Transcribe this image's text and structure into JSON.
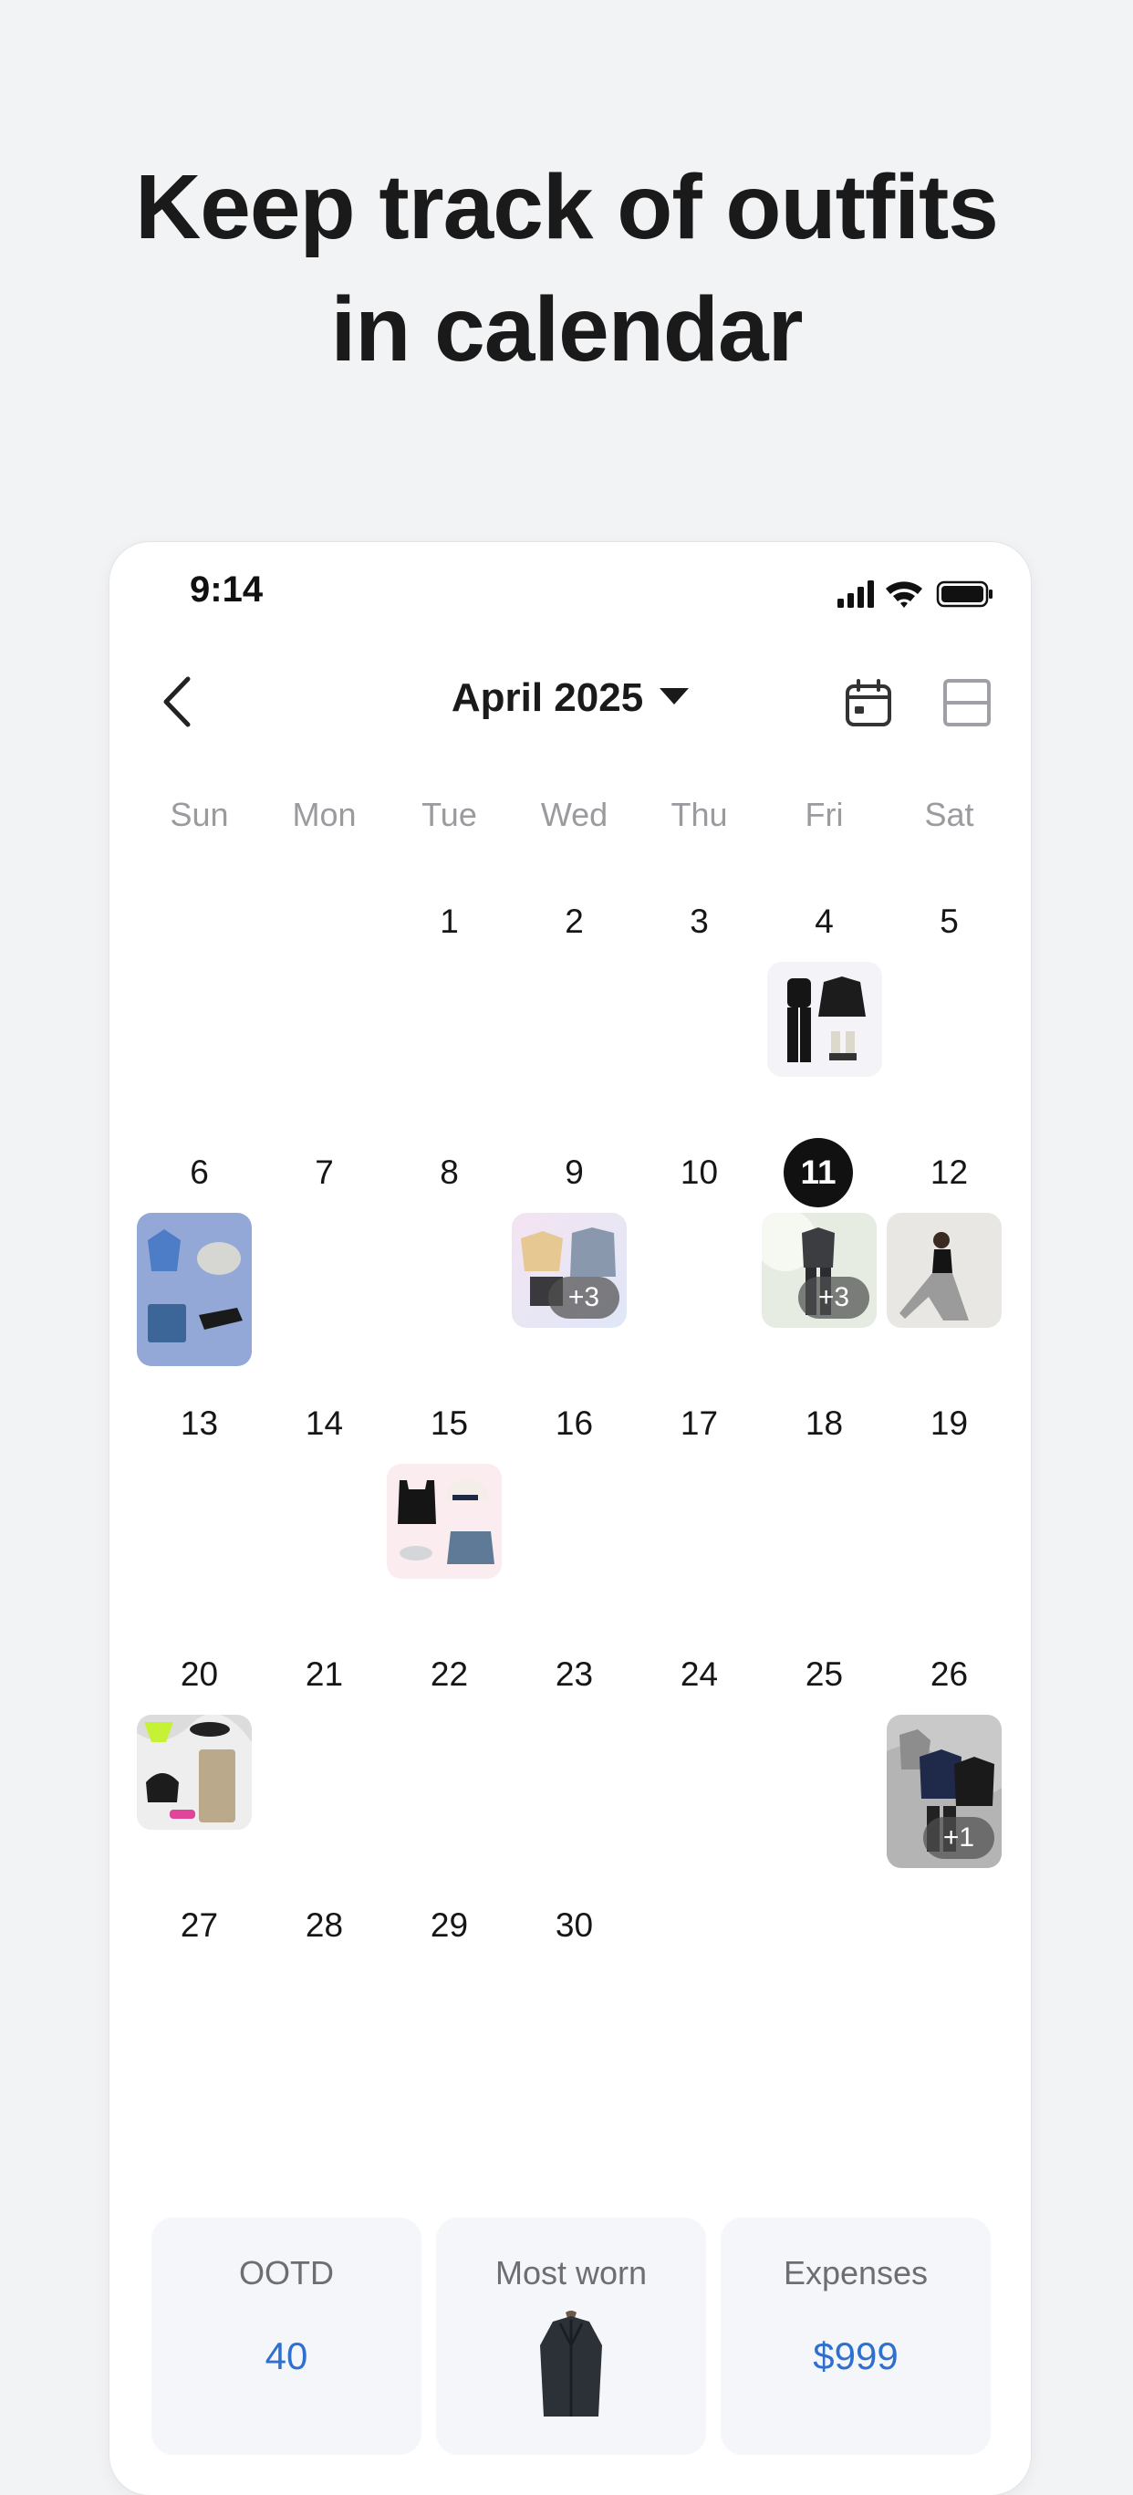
{
  "headline": {
    "line1": "Keep track of outfits",
    "line2": "in calendar"
  },
  "status_bar": {
    "time": "9:14",
    "icons": [
      "signal-icon",
      "wifi-icon",
      "battery-icon"
    ]
  },
  "header": {
    "back_icon": "chevron-left-icon",
    "month_label": "April 2025",
    "month_dropdown_icon": "caret-down-icon",
    "calendar_view_icon": "calendar-icon",
    "split_view_icon": "split-layout-icon"
  },
  "weekdays": [
    "Sun",
    "Mon",
    "Tue",
    "Wed",
    "Thu",
    "Fri",
    "Sat"
  ],
  "today": "11",
  "calendar_weeks": [
    [
      "",
      "",
      "1",
      "2",
      "3",
      "4",
      "5"
    ],
    [
      "6",
      "7",
      "8",
      "9",
      "10",
      "11",
      "12"
    ],
    [
      "13",
      "14",
      "15",
      "16",
      "17",
      "18",
      "19"
    ],
    [
      "20",
      "21",
      "22",
      "23",
      "24",
      "25",
      "26"
    ],
    [
      "27",
      "28",
      "29",
      "30",
      "",
      "",
      ""
    ]
  ],
  "outfit_badges": {
    "apr9": "+3",
    "apr11": "+3",
    "apr26": "+1"
  },
  "stats": {
    "ootd": {
      "label": "OOTD",
      "value": "40"
    },
    "most_worn": {
      "label": "Most worn",
      "item_icon": "coat-icon"
    },
    "expenses": {
      "label": "Expenses",
      "value": "$999"
    }
  },
  "colors": {
    "accent_blue": "#2f6fcf",
    "today_circle": "#111111",
    "background": "#f2f3f5"
  }
}
